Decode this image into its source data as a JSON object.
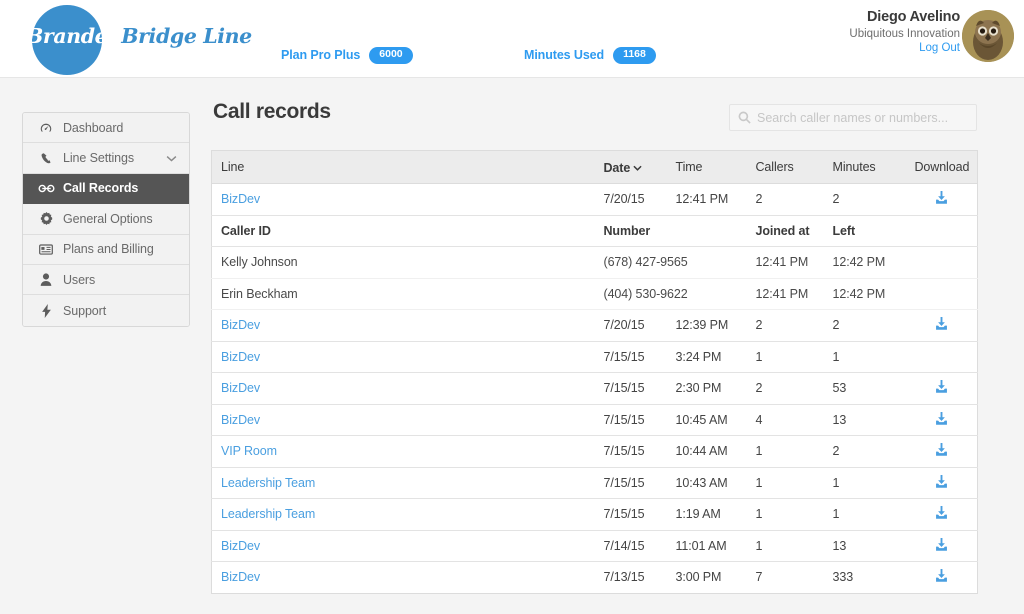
{
  "brand": {
    "name_part1": "Branded",
    "name_part2": "Bridge Line",
    "accent_color": "#2e9bf0",
    "logo_circle_color": "#3b8fcc"
  },
  "header": {
    "plan_label": "Plan Pro Plus",
    "plan_value": "6000",
    "minutes_label": "Minutes Used",
    "minutes_value": "1168",
    "account_name": "Diego Avelino",
    "account_org": "Ubiquitous Innovation",
    "logout_label": "Log Out",
    "avatar_icon": "owl-avatar"
  },
  "sidebar": {
    "items": [
      {
        "label": "Dashboard",
        "icon": "speedometer-icon",
        "active": false,
        "chevron": false
      },
      {
        "label": "Line Settings",
        "icon": "phone-icon",
        "active": false,
        "chevron": true
      },
      {
        "label": "Call Records",
        "icon": "call-records-icon",
        "active": true,
        "chevron": false
      },
      {
        "label": "General Options",
        "icon": "gear-icon",
        "active": false,
        "chevron": false
      },
      {
        "label": "Plans and Billing",
        "icon": "credit-card-icon",
        "active": false,
        "chevron": false
      },
      {
        "label": "Users",
        "icon": "user-icon",
        "active": false,
        "chevron": false
      },
      {
        "label": "Support",
        "icon": "bolt-icon",
        "active": false,
        "chevron": false
      }
    ]
  },
  "main": {
    "page_title": "Call records",
    "search": {
      "placeholder": "Search caller names or numbers...",
      "value": "",
      "icon": "search-icon"
    },
    "table": {
      "columns": [
        "Line",
        "Date",
        "Time",
        "Callers",
        "Minutes",
        "Download"
      ],
      "sorted_column": "Date",
      "sort_direction": "desc",
      "download_icon": "download-icon",
      "detail_columns": [
        "Caller ID",
        "Number",
        "Joined at",
        "Left"
      ],
      "rows": [
        {
          "line": "BizDev",
          "date": "7/20/15",
          "time": "12:41 PM",
          "callers": "2",
          "minutes": "2",
          "download": true,
          "expanded": true,
          "details": [
            {
              "caller_id": "Kelly Johnson",
              "number": "(678) 427-9565",
              "joined_at": "12:41 PM",
              "left": "12:42 PM"
            },
            {
              "caller_id": "Erin Beckham",
              "number": "(404) 530-9622",
              "joined_at": "12:41 PM",
              "left": "12:42 PM"
            }
          ]
        },
        {
          "line": "BizDev",
          "date": "7/20/15",
          "time": "12:39 PM",
          "callers": "2",
          "minutes": "2",
          "download": true,
          "expanded": false,
          "details": []
        },
        {
          "line": "BizDev",
          "date": "7/15/15",
          "time": "3:24 PM",
          "callers": "1",
          "minutes": "1",
          "download": false,
          "expanded": false,
          "details": []
        },
        {
          "line": "BizDev",
          "date": "7/15/15",
          "time": "2:30 PM",
          "callers": "2",
          "minutes": "53",
          "download": true,
          "expanded": false,
          "details": []
        },
        {
          "line": "BizDev",
          "date": "7/15/15",
          "time": "10:45 AM",
          "callers": "4",
          "minutes": "13",
          "download": true,
          "expanded": false,
          "details": []
        },
        {
          "line": "VIP Room",
          "date": "7/15/15",
          "time": "10:44 AM",
          "callers": "1",
          "minutes": "2",
          "download": true,
          "expanded": false,
          "details": []
        },
        {
          "line": "Leadership Team",
          "date": "7/15/15",
          "time": "10:43 AM",
          "callers": "1",
          "minutes": "1",
          "download": true,
          "expanded": false,
          "details": []
        },
        {
          "line": "Leadership Team",
          "date": "7/15/15",
          "time": "1:19 AM",
          "callers": "1",
          "minutes": "1",
          "download": true,
          "expanded": false,
          "details": []
        },
        {
          "line": "BizDev",
          "date": "7/14/15",
          "time": "11:01 AM",
          "callers": "1",
          "minutes": "13",
          "download": true,
          "expanded": false,
          "details": []
        },
        {
          "line": "BizDev",
          "date": "7/13/15",
          "time": "3:00 PM",
          "callers": "7",
          "minutes": "333",
          "download": true,
          "expanded": false,
          "details": []
        }
      ]
    }
  }
}
